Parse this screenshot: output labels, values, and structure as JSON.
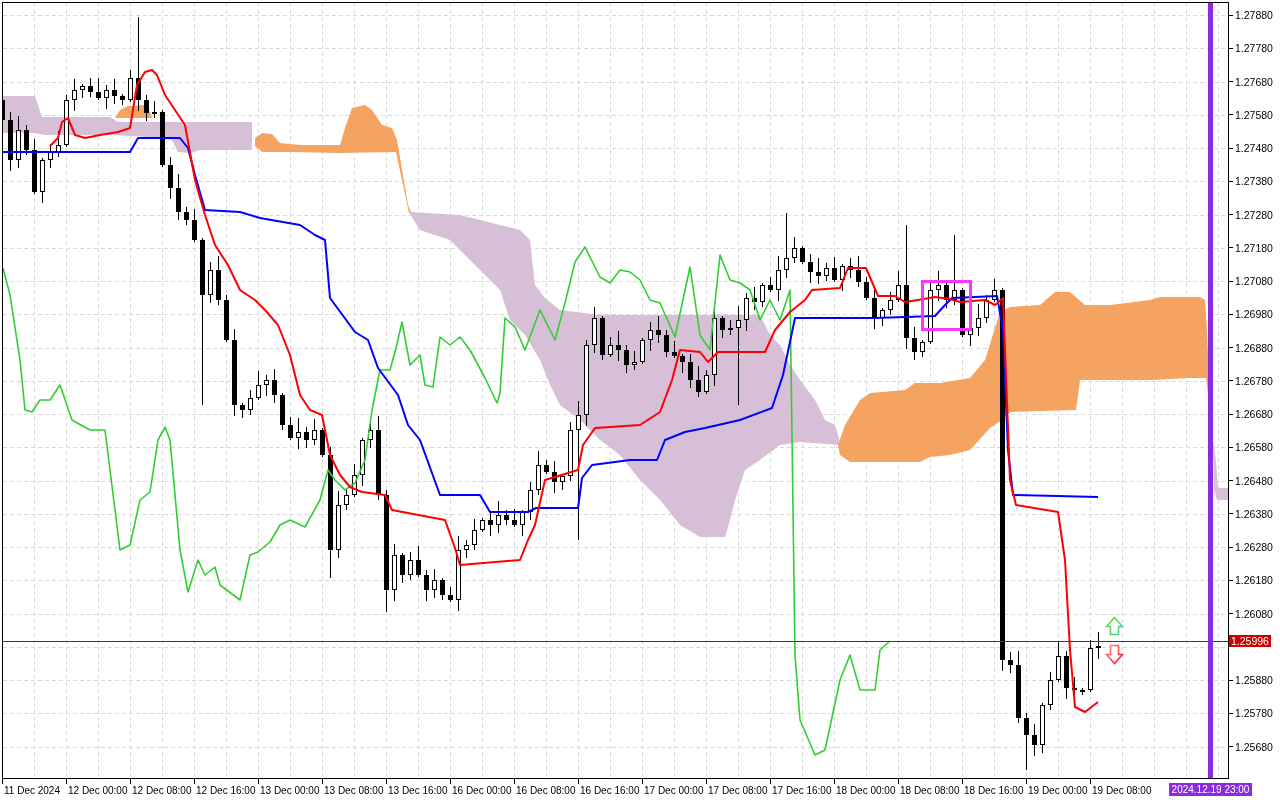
{
  "price_axis": {
    "upper_labels": [
      "1.27880",
      "1.27780",
      "1.27680",
      "1.27580",
      "1.27480",
      "1.27380",
      "1.27280",
      "1.27180",
      "1.27080",
      "1.26980",
      "1.26880",
      "1.26780",
      "1.26680",
      "1.26580",
      "1.26480",
      "1.26380",
      "1.26280",
      "1.26180",
      "1.26080"
    ],
    "lower_labels": [
      "1.25880",
      "1.25780",
      "1.25680"
    ]
  },
  "current_price": {
    "label": "1.25996"
  },
  "time_axis": {
    "labels": [
      "11 Dec 2024",
      "12 Dec 00:00",
      "12 Dec 08:00",
      "12 Dec 16:00",
      "13 Dec 00:00",
      "13 Dec 08:00",
      "13 Dec 16:00",
      "16 Dec 00:00",
      "16 Dec 08:00",
      "16 Dec 16:00",
      "17 Dec 00:00",
      "17 Dec 08:00",
      "17 Dec 16:00",
      "18 Dec 00:00",
      "18 Dec 08:00",
      "18 Dec 16:00",
      "19 Dec 00:00",
      "19 Dec 08:00"
    ]
  },
  "cursor_time": {
    "label": "2024.12.19 23:00"
  }
}
